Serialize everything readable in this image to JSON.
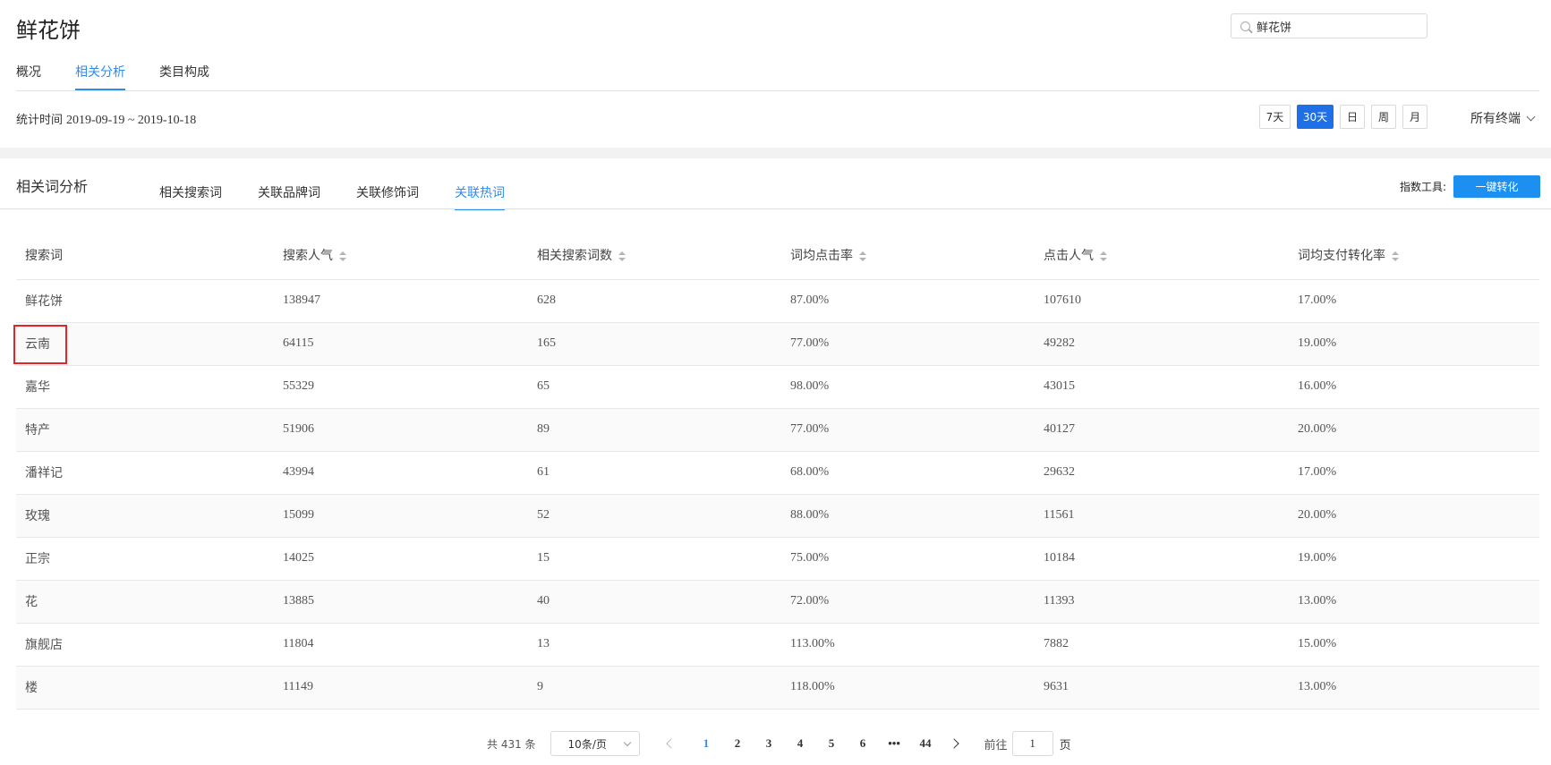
{
  "page": {
    "title": "鲜花饼"
  },
  "search": {
    "value": "鲜花饼"
  },
  "top_tabs": [
    {
      "label": "概况",
      "active": false
    },
    {
      "label": "相关分析",
      "active": true
    },
    {
      "label": "类目构成",
      "active": false
    }
  ],
  "stat_period": {
    "label": "统计时间",
    "range": "2019-09-19 ~ 2019-10-18"
  },
  "period_buttons": [
    {
      "label": "7天",
      "active": false
    },
    {
      "label": "30天",
      "active": true
    },
    {
      "label": "日",
      "active": false
    },
    {
      "label": "周",
      "active": false
    },
    {
      "label": "月",
      "active": false
    }
  ],
  "terminal": {
    "label": "所有终端"
  },
  "section": {
    "title": "相关词分析",
    "tabs": [
      {
        "label": "相关搜索词",
        "active": false
      },
      {
        "label": "关联品牌词",
        "active": false
      },
      {
        "label": "关联修饰词",
        "active": false
      },
      {
        "label": "关联热词",
        "active": true
      }
    ],
    "tool_label": "指数工具:",
    "tool_button": "一键转化"
  },
  "table": {
    "columns": [
      "搜索词",
      "搜索人气",
      "相关搜索词数",
      "词均点击率",
      "点击人气",
      "词均支付转化率"
    ],
    "rows": [
      [
        "鲜花饼",
        "138947",
        "628",
        "87.00%",
        "107610",
        "17.00%"
      ],
      [
        "云南",
        "64115",
        "165",
        "77.00%",
        "49282",
        "19.00%"
      ],
      [
        "嘉华",
        "55329",
        "65",
        "98.00%",
        "43015",
        "16.00%"
      ],
      [
        "特产",
        "51906",
        "89",
        "77.00%",
        "40127",
        "20.00%"
      ],
      [
        "潘祥记",
        "43994",
        "61",
        "68.00%",
        "29632",
        "17.00%"
      ],
      [
        "玫瑰",
        "15099",
        "52",
        "88.00%",
        "11561",
        "20.00%"
      ],
      [
        "正宗",
        "14025",
        "15",
        "75.00%",
        "10184",
        "19.00%"
      ],
      [
        "花",
        "13885",
        "40",
        "72.00%",
        "11393",
        "13.00%"
      ],
      [
        "旗舰店",
        "11804",
        "13",
        "113.00%",
        "7882",
        "15.00%"
      ],
      [
        "楼",
        "11149",
        "9",
        "118.00%",
        "9631",
        "13.00%"
      ]
    ]
  },
  "pagination": {
    "total": "共 431 条",
    "page_size": "10条/页",
    "pages": [
      "1",
      "2",
      "3",
      "4",
      "5",
      "6",
      "•••",
      "44"
    ],
    "current": "1",
    "goto_label": "前往",
    "goto_value": "1",
    "goto_suffix": "页"
  },
  "colors": {
    "accent": "#2d8cf0",
    "primary_button": "#1f6fe6",
    "highlight_box": "#e0262b"
  }
}
